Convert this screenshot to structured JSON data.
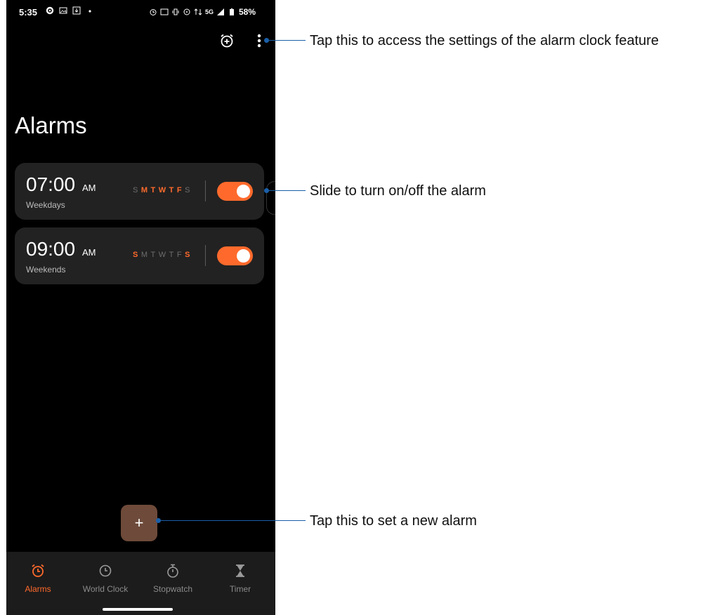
{
  "status_bar": {
    "time": "5:35",
    "battery": "58%",
    "network": "5G"
  },
  "page": {
    "title": "Alarms"
  },
  "alarms": [
    {
      "time": "07:00",
      "ampm": "AM",
      "label": "Weekdays",
      "days": [
        "S",
        "M",
        "T",
        "W",
        "T",
        "F",
        "S"
      ],
      "active_days": [
        false,
        true,
        true,
        true,
        true,
        true,
        false
      ],
      "enabled": true
    },
    {
      "time": "09:00",
      "ampm": "AM",
      "label": "Weekends",
      "days": [
        "S",
        "M",
        "T",
        "W",
        "T",
        "F",
        "S"
      ],
      "active_days": [
        true,
        false,
        false,
        false,
        false,
        false,
        true
      ],
      "enabled": true
    }
  ],
  "fab": {
    "label": "+"
  },
  "bottom_nav": [
    {
      "label": "Alarms",
      "icon": "alarm-clock-icon",
      "active": true
    },
    {
      "label": "World Clock",
      "icon": "clock-icon",
      "active": false
    },
    {
      "label": "Stopwatch",
      "icon": "stopwatch-icon",
      "active": false
    },
    {
      "label": "Timer",
      "icon": "hourglass-icon",
      "active": false
    }
  ],
  "callouts": {
    "settings": "Tap this to access the settings of the alarm clock feature",
    "toggle": "Slide to turn on/off the alarm",
    "new_alarm": "Tap this to set a new alarm"
  },
  "colors": {
    "accent": "#ff6a2c",
    "fab": "#6e4a3a",
    "callout": "#1a5fa8"
  }
}
